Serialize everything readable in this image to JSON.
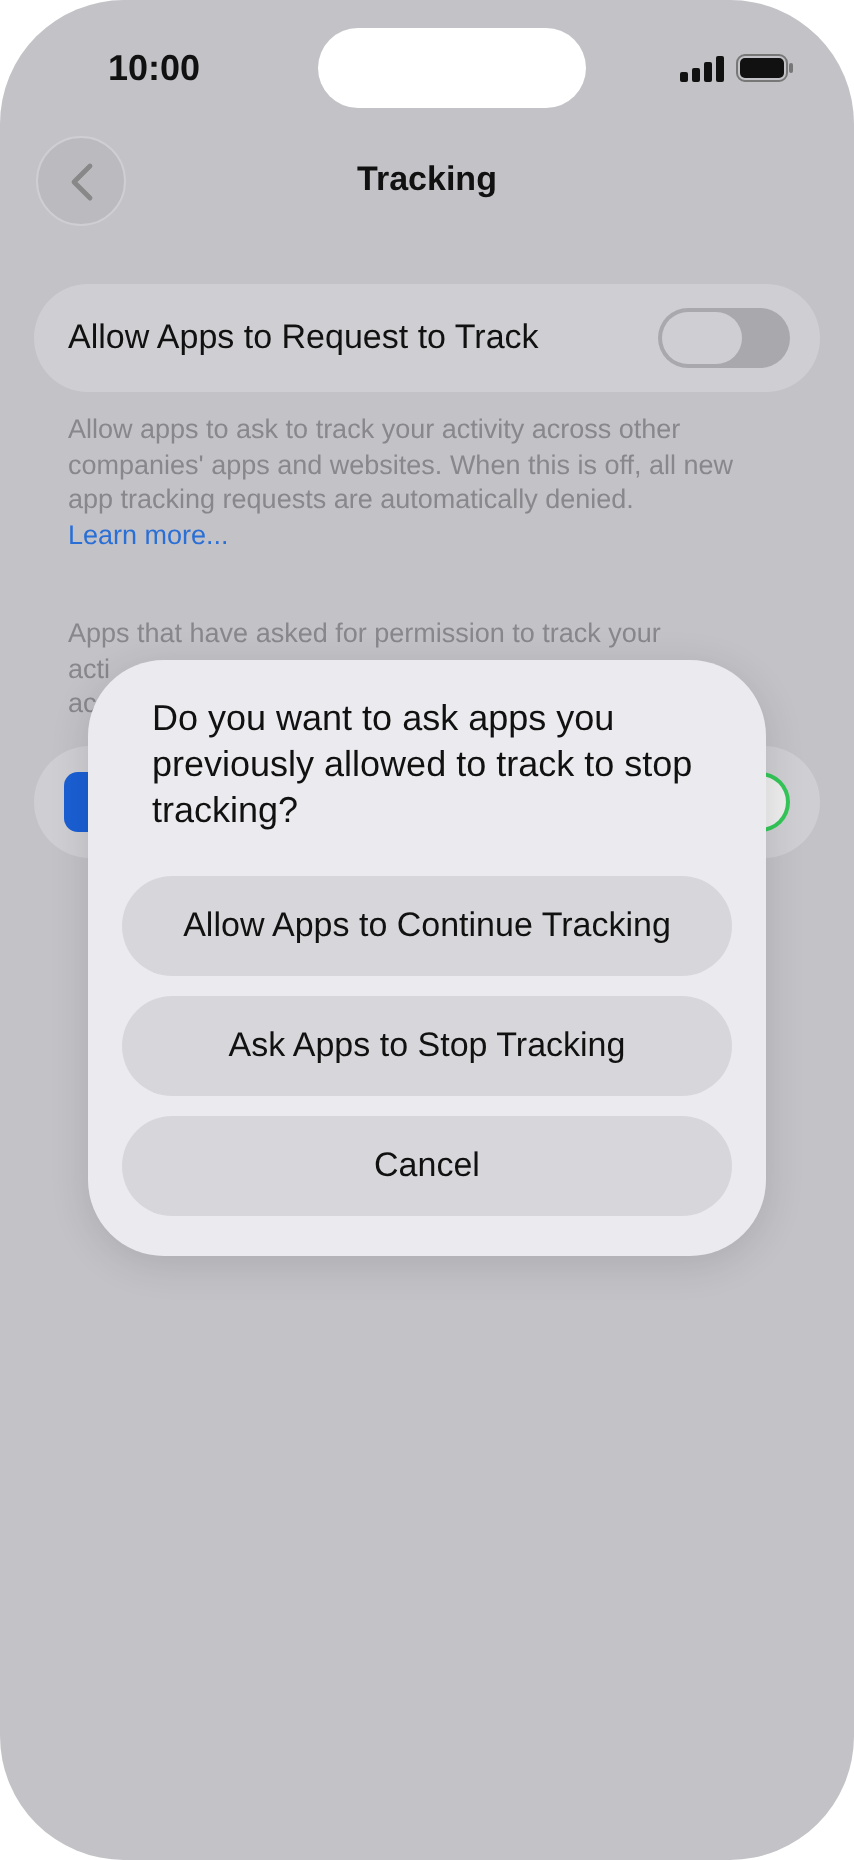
{
  "status_bar": {
    "time": "10:00"
  },
  "nav": {
    "title": "Tracking"
  },
  "setting": {
    "label": "Allow Apps to Request to Track",
    "on": false
  },
  "footer": {
    "text": "Allow apps to ask to track your activity across other companies' apps and websites. When this is off, all new app tracking requests are automatically denied.",
    "link": "Learn more..."
  },
  "apps_note": {
    "lines": [
      "Apps that have asked for permission to track your",
      "acti",
      "ac"
    ]
  },
  "app_row": {
    "on": true
  },
  "alert": {
    "message": "Do you want to ask apps you previously allowed to track to stop tracking?",
    "buttons": [
      "Allow Apps to Continue Tracking",
      "Ask Apps to Stop Tracking",
      "Cancel"
    ]
  }
}
